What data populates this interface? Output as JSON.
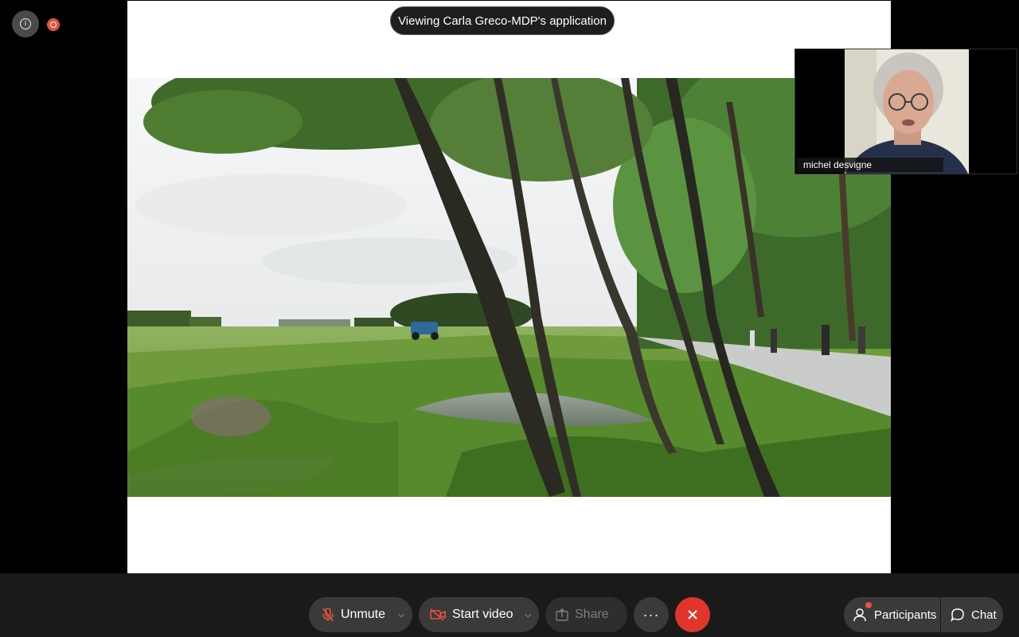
{
  "banner": {
    "viewing_text": "Viewing Carla Greco-MDP's application"
  },
  "participant_video": {
    "name": "michel desvigne"
  },
  "toolbar": {
    "unmute_label": "Unmute",
    "start_video_label": "Start video",
    "share_label": "Share",
    "more_label": "···",
    "participants_label": "Participants",
    "chat_label": "Chat"
  },
  "colors": {
    "background": "#000000",
    "toolbar": "#1a1a1a",
    "button": "#3a3a3a",
    "leave": "#e0352b",
    "recording": "#e5533f",
    "mic_muted_icon": "#e5533f"
  },
  "icons": [
    "info-icon",
    "recording-icon",
    "mic-muted-icon",
    "camera-off-icon",
    "share-icon",
    "more-icon",
    "close-icon",
    "participants-icon",
    "chat-icon",
    "chevron-down-icon"
  ]
}
